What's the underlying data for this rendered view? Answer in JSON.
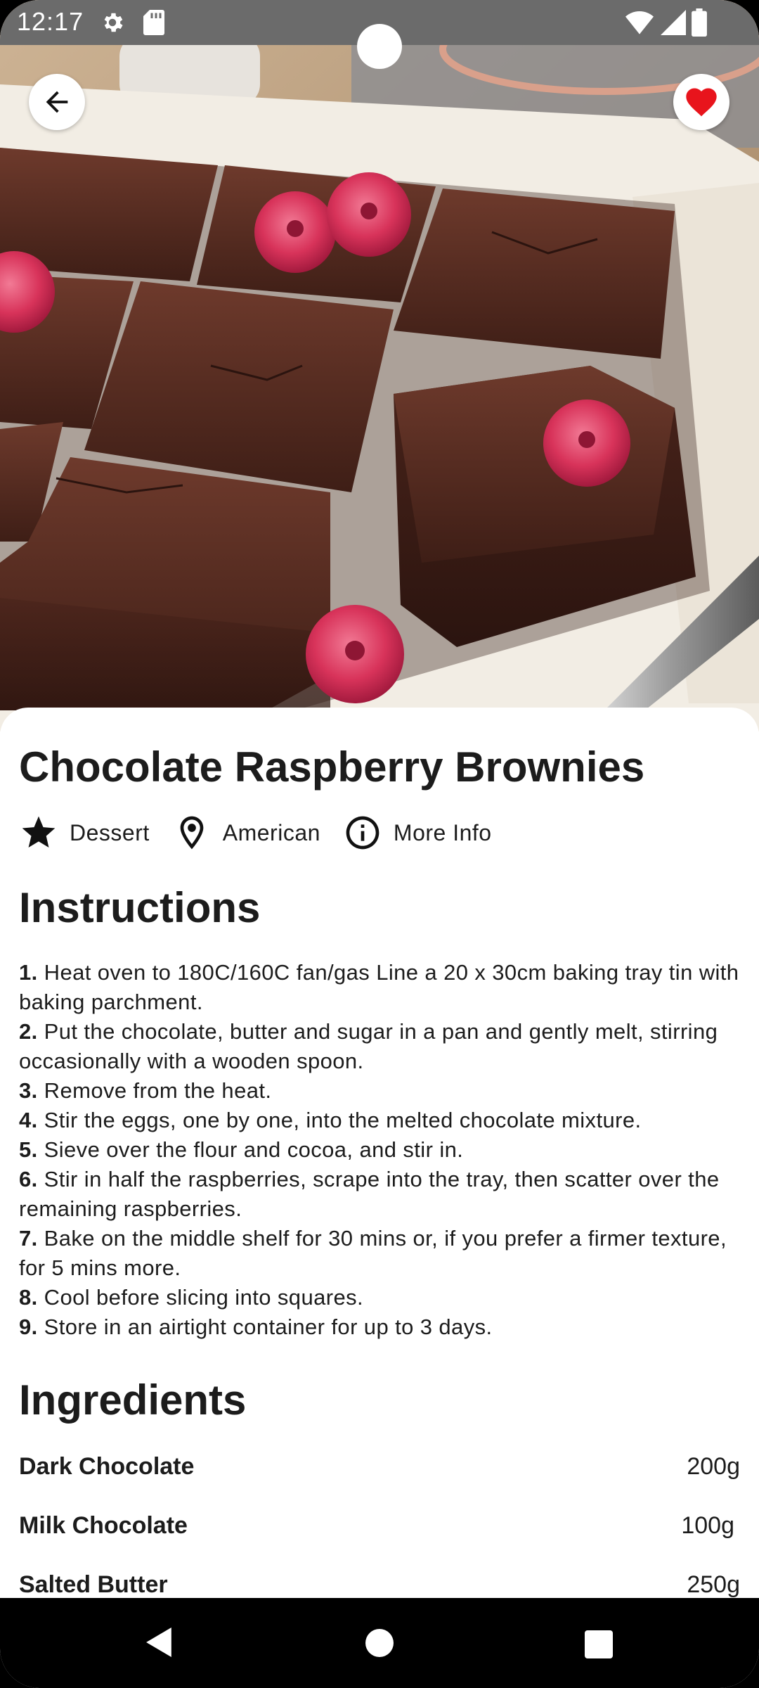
{
  "status_bar": {
    "time": "12:17",
    "icons": [
      "gear-icon",
      "sd-card-icon",
      "wifi-icon",
      "signal-icon",
      "battery-icon"
    ]
  },
  "header": {
    "back_icon": "arrow-left-icon",
    "favorite_icon": "heart-icon",
    "favorite_color": "#e8141c",
    "is_favorite": true
  },
  "hero": {
    "image_subject": "brownies-with-raspberries"
  },
  "recipe": {
    "title": "Chocolate Raspberry Brownies",
    "category": "Dessert",
    "area": "American",
    "more_info_label": "More Info"
  },
  "instructions": {
    "heading": "Instructions",
    "steps": [
      {
        "num": "1.",
        "text": "Heat oven to 180C/160C fan/gas Line a 20 x 30cm baking tray tin with baking parchment."
      },
      {
        "num": "2.",
        "text": "Put the chocolate, butter and sugar in a pan and gently melt, stirring occasionally with a wooden spoon."
      },
      {
        "num": "3.",
        "text": "Remove from the heat."
      },
      {
        "num": "4.",
        "text": "Stir the eggs, one by one, into the melted chocolate mixture."
      },
      {
        "num": "5.",
        "text": "Sieve over the flour and cocoa, and stir in."
      },
      {
        "num": "6.",
        "text": "Stir in half the raspberries, scrape into the tray, then scatter over the remaining raspberries."
      },
      {
        "num": "7.",
        "text": "Bake on the middle shelf for 30 mins or, if you prefer a firmer texture, for 5 mins more."
      },
      {
        "num": "8.",
        "text": "Cool before slicing into squares."
      },
      {
        "num": "9.",
        "text": "Store in an airtight container for up to 3 days."
      }
    ]
  },
  "ingredients": {
    "heading": "Ingredients",
    "items": [
      {
        "name": "Dark Chocolate",
        "quantity": "200g"
      },
      {
        "name": "Milk Chocolate",
        "quantity": "100g"
      },
      {
        "name": "Salted Butter",
        "quantity": "250g"
      }
    ]
  },
  "nav_bar": {
    "icons": [
      "nav-back-icon",
      "nav-home-icon",
      "nav-recents-icon"
    ]
  }
}
